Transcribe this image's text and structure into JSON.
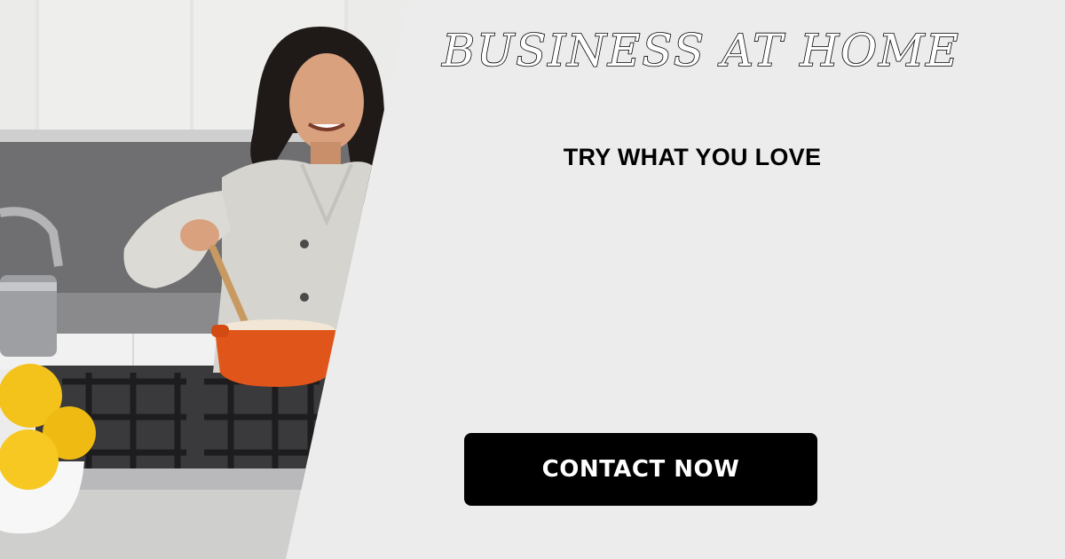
{
  "banner": {
    "headline": "BUSINESS AT HOME",
    "tagline": "TRY WHAT YOU LOVE",
    "cta_label": "CONTACT NOW"
  },
  "colors": {
    "background": "#ececec",
    "cta_background": "#000000",
    "cta_text": "#ffffff",
    "headline_fill": "#ffffff",
    "headline_outline": "#000000",
    "pot_accent": "#e0561a",
    "lemon": "#f3c21b"
  },
  "image": {
    "subject": "woman-cooking-icon"
  }
}
